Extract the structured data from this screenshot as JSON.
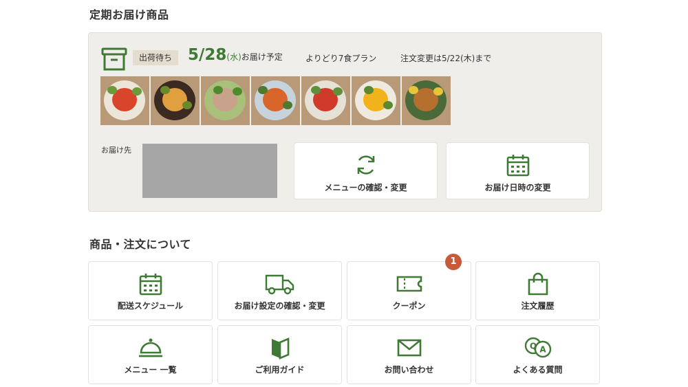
{
  "section1": {
    "title": "定期お届け商品"
  },
  "delivery": {
    "status": "出荷待ち",
    "date": "5/28",
    "day_of_week": "(水)",
    "date_suffix": "お届け予定",
    "plan": "よりどり7食プラン",
    "deadline": "注文変更は5/22(木)まで",
    "destination_label": "お届け先",
    "dishes": [
      {
        "name": "dish-1",
        "plate": "#ece6da",
        "food": "#d9452b",
        "greens": "#6a9a3a"
      },
      {
        "name": "dish-2",
        "plate": "#3a2a22",
        "food": "#e0a040",
        "greens": "#6a8a2a"
      },
      {
        "name": "dish-3",
        "plate": "#a8c07a",
        "food": "#c8a28a",
        "greens": "#4f8a2f"
      },
      {
        "name": "dish-4",
        "plate": "#c6d2dc",
        "food": "#d8652a",
        "greens": "#4f7a2f"
      },
      {
        "name": "dish-5",
        "plate": "#e6e1d6",
        "food": "#cf3a2a",
        "greens": "#5f8f3a"
      },
      {
        "name": "dish-6",
        "plate": "#efeae0",
        "food": "#f2b21b",
        "greens": "#5a8a2f"
      },
      {
        "name": "dish-7",
        "plate": "#4a6a3a",
        "food": "#b5702f",
        "greens": "#e8c43a"
      }
    ]
  },
  "actions": {
    "menu_confirm_label": "メニューの確認・変更",
    "date_change_label": "お届け日時の変更"
  },
  "section2": {
    "title": "商品・注文について"
  },
  "tiles": {
    "schedule": "配送スケジュール",
    "delivery_settings": "お届け設定の確認・変更",
    "coupon": "クーポン",
    "coupon_badge": "1",
    "order_history": "注文履歴",
    "menu_list": "メニュー 一覧",
    "guide": "ご利用ガイド",
    "contact": "お問い合わせ",
    "faq": "よくある質問"
  },
  "colors": {
    "accent": "#3e7a34",
    "card_bg": "#f0eeea",
    "badge": "#c85a3a"
  }
}
